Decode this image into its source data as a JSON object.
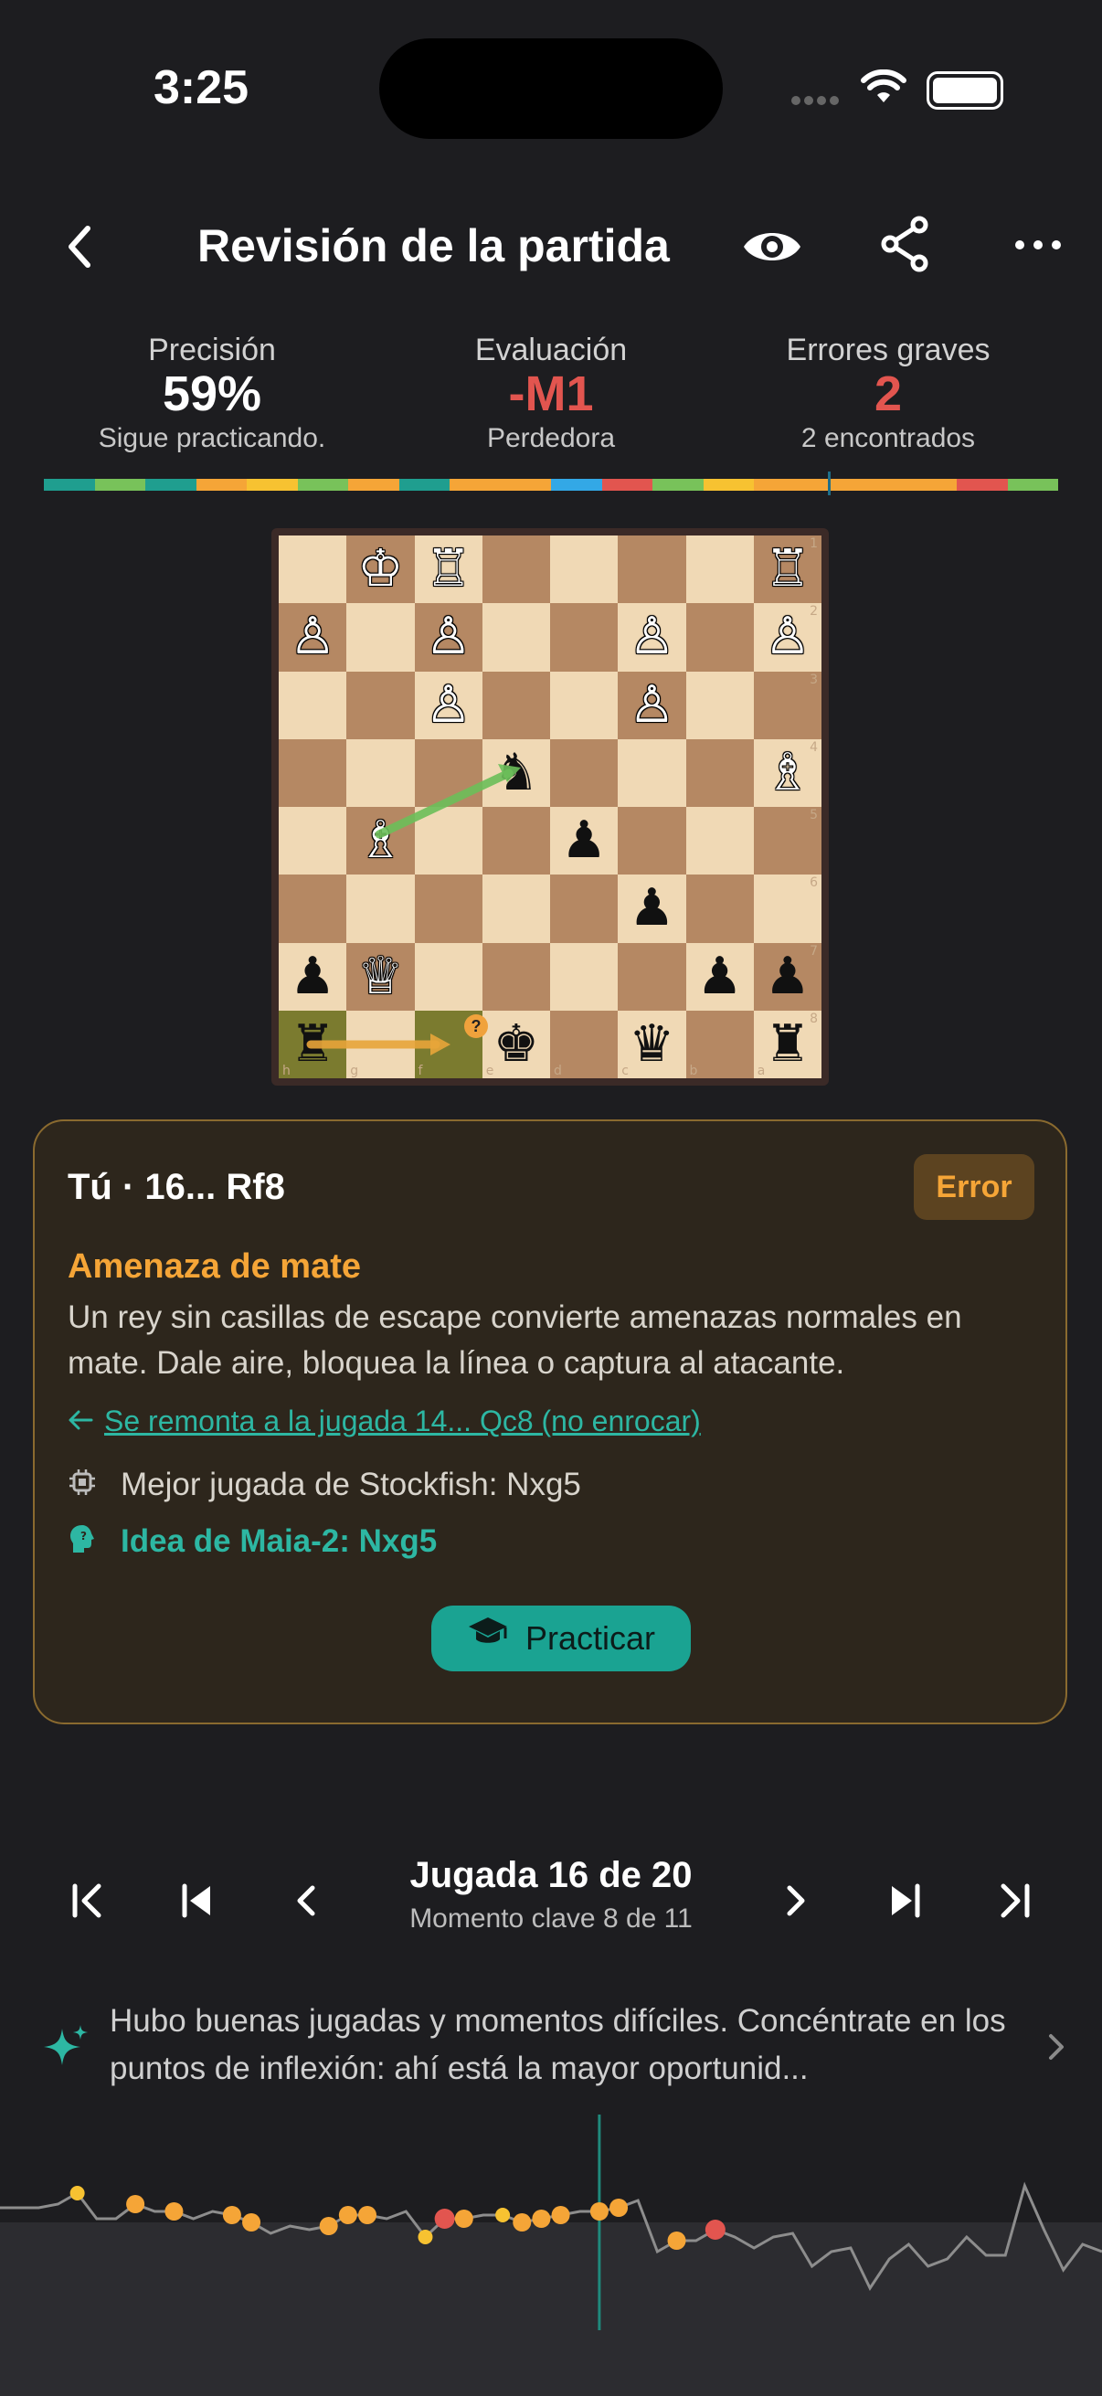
{
  "status": {
    "time": "3:25"
  },
  "header": {
    "title": "Revisión de la partida"
  },
  "stats": [
    {
      "label": "Precisión",
      "value": "59%",
      "sub": "Sigue practicando."
    },
    {
      "label": "Evaluación",
      "value": "-M1",
      "sub": "Perdedora"
    },
    {
      "label": "Errores graves",
      "value": "2",
      "sub": "2 encontrados"
    }
  ],
  "colors": {
    "accent": "#1aa392",
    "error": "#f5a537",
    "blunder": "#e2554f",
    "good": "#78c25a",
    "best": "#1f9e8f",
    "inaccuracy": "#f7c231",
    "great": "#33a8e6"
  },
  "accuracy_strip": [
    "best",
    "good",
    "best",
    "error",
    "inaccuracy",
    "good",
    "error",
    "best",
    "error",
    "error",
    "great",
    "blunder",
    "good",
    "inaccuracy",
    "error",
    "error",
    "error",
    "error",
    "blunder",
    "good"
  ],
  "board": {
    "files": [
      "h",
      "g",
      "f",
      "e",
      "d",
      "c",
      "b",
      "a"
    ],
    "ranks": [
      "1",
      "2",
      "3",
      "4",
      "5",
      "6",
      "7",
      "8"
    ],
    "rows": [
      [
        "",
        "wK",
        "wR",
        "",
        "",
        "",
        "",
        "wR"
      ],
      [
        "wP",
        "",
        "wP",
        "",
        "",
        "wP",
        "",
        "wP"
      ],
      [
        "",
        "",
        "wP",
        "",
        "",
        "wP",
        "",
        ""
      ],
      [
        "",
        "",
        "",
        "bN",
        "",
        "",
        "",
        "wB"
      ],
      [
        "",
        "wB",
        "",
        "",
        "bP",
        "",
        "",
        ""
      ],
      [
        "",
        "",
        "",
        "",
        "",
        "bP",
        "",
        ""
      ],
      [
        "bP",
        "wQ",
        "",
        "",
        "",
        "",
        "bP",
        "bP"
      ],
      [
        "bR",
        "",
        "",
        "bK",
        "",
        "bQ",
        "",
        "bR"
      ]
    ],
    "badge": "?"
  },
  "card": {
    "move": "Tú · 16... Rf8",
    "badge": "Error",
    "threat_title": "Amenaza de mate",
    "threat_desc": "Un rey sin casillas de escape convierte amenazas normales en mate. Dale aire, bloquea la línea o captura al atacante.",
    "link": "Se remonta a la jugada 14... Qc8 (no enrocar)",
    "stockfish": "Mejor jugada de Stockfish: Nxg5",
    "maia": "Idea de Maia-2: Nxg5",
    "practice_label": "Practicar"
  },
  "nav": {
    "title": "Jugada 16 de 20",
    "subtitle": "Momento clave 8 de 11"
  },
  "summary": {
    "text": "Hubo buenas jugadas y momentos difíciles. Concéntrate en los puntos de inflexión: ahí está la mayor oportunid..."
  },
  "eval_graph": {
    "values": [
      0.4,
      0.4,
      0.4,
      0.5,
      0.8,
      0.1,
      0.1,
      0.5,
      0.3,
      0.3,
      0.1,
      0.3,
      0.2,
      0.0,
      -0.3,
      -0.1,
      -0.2,
      -0.1,
      0.2,
      0.2,
      0.1,
      0.3,
      -0.4,
      0.1,
      0.1,
      0.2,
      0.2,
      0.0,
      0.1,
      0.2,
      0.3,
      0.3,
      0.4,
      0.6,
      -0.8,
      -0.5,
      -0.5,
      -0.2,
      -0.4,
      -0.7,
      -0.4,
      -0.3,
      -1.2,
      -0.8,
      -0.7,
      -1.8,
      -1.0,
      -0.6,
      -1.2,
      -1.0,
      -0.4,
      -0.9,
      -0.9,
      1.0,
      -0.2,
      -1.3,
      -0.6,
      -0.8
    ],
    "markers": [
      {
        "i": 4,
        "type": "inaccuracy"
      },
      {
        "i": 7,
        "type": "error"
      },
      {
        "i": 9,
        "type": "error"
      },
      {
        "i": 12,
        "type": "error"
      },
      {
        "i": 13,
        "type": "error"
      },
      {
        "i": 17,
        "type": "error"
      },
      {
        "i": 18,
        "type": "error"
      },
      {
        "i": 19,
        "type": "error"
      },
      {
        "i": 22,
        "type": "inaccuracy"
      },
      {
        "i": 23,
        "type": "blunder"
      },
      {
        "i": 24,
        "type": "error"
      },
      {
        "i": 26,
        "type": "inaccuracy"
      },
      {
        "i": 27,
        "type": "error"
      },
      {
        "i": 28,
        "type": "error"
      },
      {
        "i": 29,
        "type": "error"
      },
      {
        "i": 31,
        "type": "error"
      },
      {
        "i": 32,
        "type": "error"
      },
      {
        "i": 35,
        "type": "error"
      },
      {
        "i": 37,
        "type": "blunder"
      }
    ],
    "current_index": 31
  }
}
